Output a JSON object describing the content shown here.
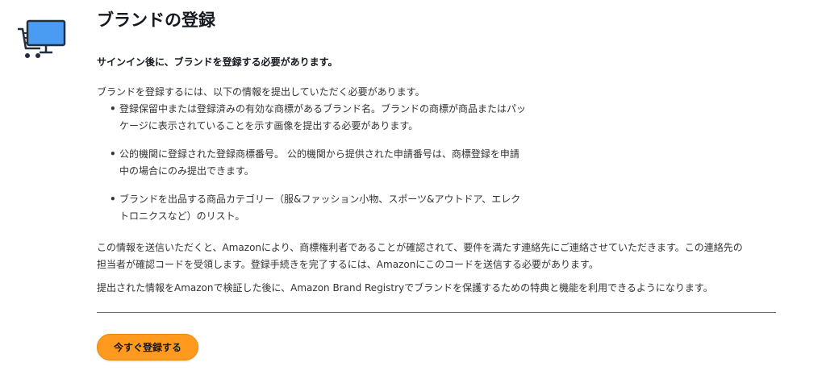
{
  "header": {
    "title": "ブランドの登録",
    "icon": "computer-cart-icon"
  },
  "notice": "サインイン後に、ブランドを登録する必要があります。",
  "intro": "ブランドを登録するには、以下の情報を提出していただく必要があります。",
  "requirements": [
    {
      "line1": "登録保留中または登録済みの有効な商標があるブランド名。ブランドの商標が商品またはパッ",
      "line2": "ケージに表示されていることを示す画像を提出する必要があります。"
    },
    {
      "line1": "公的機関に登録された登録商標番号。 公的機関から提供された申請番号は、商標登録を申請",
      "line2": "中の場合にのみ提出できます。"
    },
    {
      "line1": "ブランドを出品する商品カテゴリー（服&ファッション小物、スポーツ&アウトドア、エレク",
      "line2": "トロニクスなど）のリスト。"
    }
  ],
  "paragraph1": {
    "line1": "この情報を送信いただくと、Amazonにより、商標権利者であることが確認されて、要件を満たす連絡先にご連絡させていただきます。この連絡先の",
    "line2": "担当者が確認コードを受領します。登録手続きを完了するには、Amazonにこのコードを送信する必要があります。"
  },
  "paragraph2": "提出された情報をAmazonで検証した後に、Amazon Brand Registryでブランドを保護するための特典と機能を利用できるようになります。",
  "button": {
    "label": "今すぐ登録する"
  },
  "colors": {
    "button": "#ff9a1f",
    "icon_screen": "#4a9cf2",
    "text_dark": "#16191f",
    "text_body": "#333333"
  }
}
